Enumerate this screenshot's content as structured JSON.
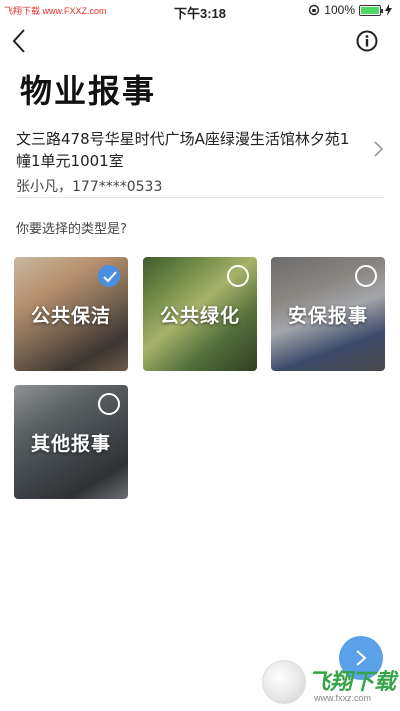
{
  "status_bar": {
    "carrier": "飞翔下载 www.FXXZ.com",
    "time": "下午3:18",
    "battery": "100%",
    "battery_level": 1.0
  },
  "nav": {
    "back_icon": "chevron-left-icon",
    "info_icon": "info-icon"
  },
  "page": {
    "title": "物业报事",
    "address": "文三路478号华星时代广场A座绿漫生活馆林夕苑1幢1单元1001室",
    "contact": "张小凡，177****0533",
    "prompt": "你要选择的类型是?"
  },
  "categories": [
    {
      "label": "公共保洁",
      "selected": true
    },
    {
      "label": "公共绿化",
      "selected": false
    },
    {
      "label": "安保报事",
      "selected": false
    },
    {
      "label": "其他报事",
      "selected": false
    }
  ],
  "colors": {
    "accent": "#4a90e2",
    "next_button": "#5aa1ea"
  },
  "watermark": {
    "brand": "飞翔下载",
    "url": "www.fxxz.com"
  }
}
